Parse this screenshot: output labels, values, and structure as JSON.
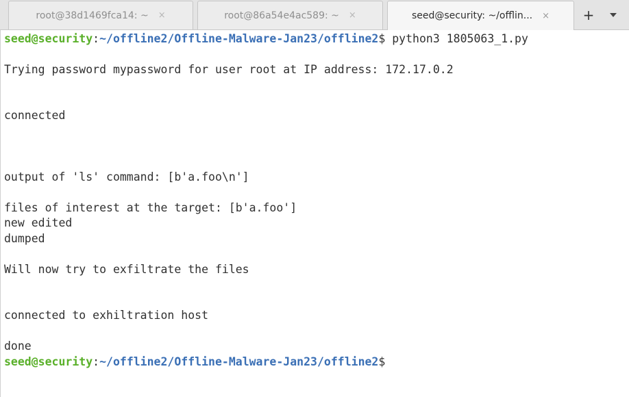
{
  "tabs": [
    {
      "label": "root@38d1469fca14: ~",
      "close": "×",
      "active": false
    },
    {
      "label": "root@86a54e4ac589: ~",
      "close": "×",
      "active": false
    },
    {
      "label": "seed@security: ~/offlin...",
      "close": "×",
      "active": true
    }
  ],
  "new_tab_label": "+",
  "terminal": {
    "prompt_user": "seed@security",
    "prompt_colon": ":",
    "prompt_path": "~/offline2/Offline-Malware-Jan23/offline2",
    "prompt_dollar": "$",
    "command": " python3 1805063_1.py",
    "lines": {
      "trying": "Trying password mypassword for user root at IP address: 172.17.0.2",
      "connected": "connected",
      "ls_output": "output of 'ls' command: [b'a.foo\\n']",
      "files": "files of interest at the target: [b'a.foo']",
      "new_edited": "new edited",
      "dumped": "dumped",
      "exfiltrate": "Will now try to exfiltrate the files",
      "exhil_host": "connected to exhiltration host",
      "done": "done"
    }
  },
  "colors": {
    "prompt_user": "#5ab02a",
    "prompt_path": "#3a6fb5",
    "text": "#303030"
  }
}
